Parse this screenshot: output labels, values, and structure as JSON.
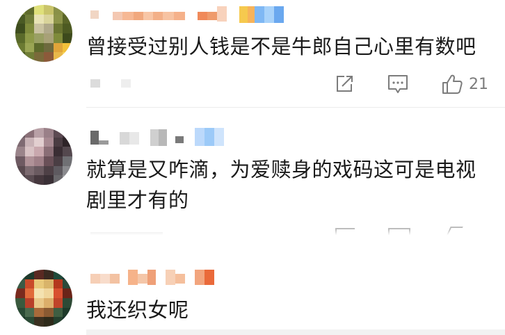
{
  "comments": [
    {
      "text": "曾接受过别人钱是不是牛郎自己心里有数吧",
      "like_count": "21"
    },
    {
      "text_line1": "就算是又咋滴，为爱赎身的戏码这可是电视",
      "text_line2": "剧里才有的"
    },
    {
      "text": "我还织女呢"
    }
  ],
  "icons": {
    "forward": "forward-icon",
    "comment": "comment-icon",
    "like": "thumbs-up-icon"
  },
  "colors": {
    "text": "#1a1a1a",
    "meta": "#7c7c7c",
    "divider": "#ececec"
  }
}
